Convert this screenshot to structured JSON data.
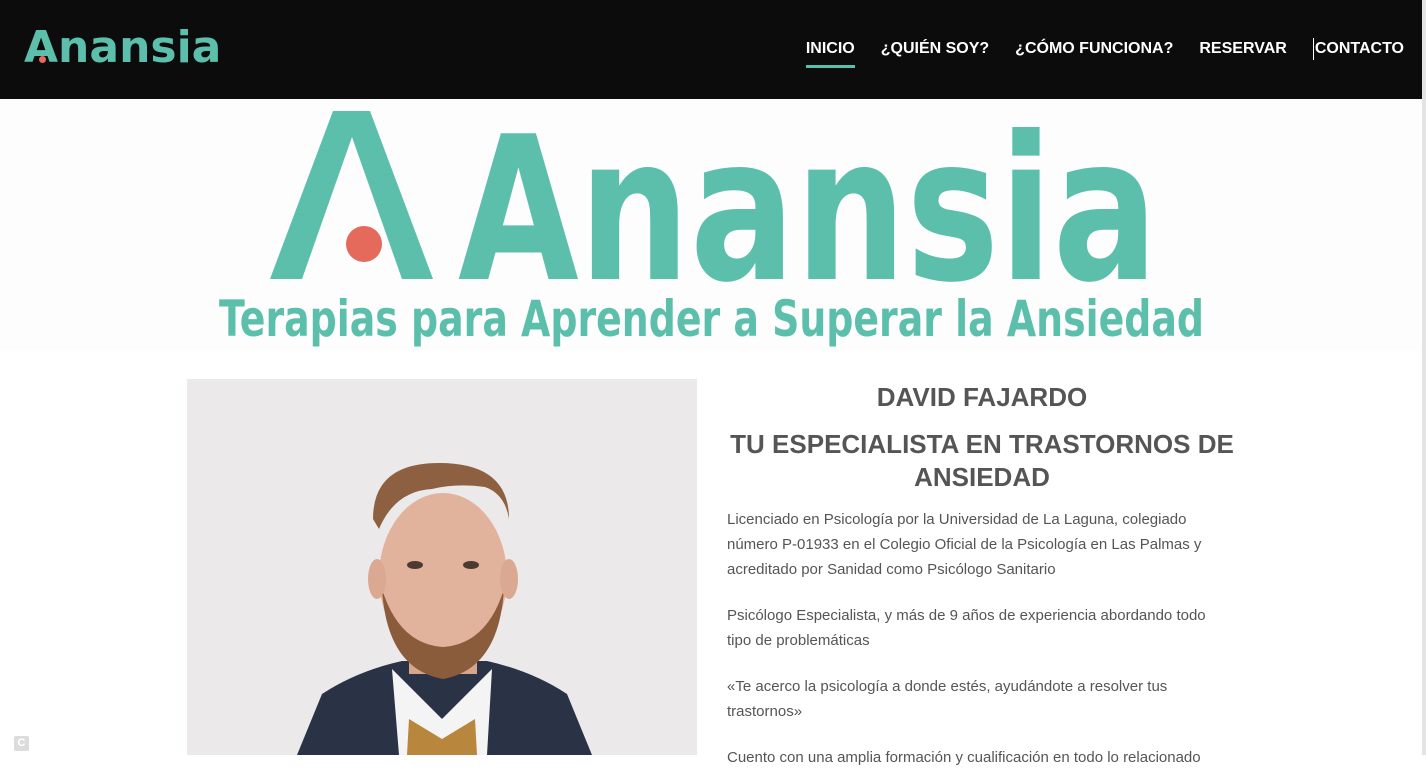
{
  "header": {
    "logo_text": "Anansia",
    "nav": [
      {
        "label": "INICIO",
        "active": true
      },
      {
        "label": "¿QUIÉN SOY?",
        "active": false
      },
      {
        "label": "¿CÓMO FUNCIONA?",
        "active": false
      },
      {
        "label": "RESERVAR",
        "active": false
      },
      {
        "label": "CONTACTO",
        "active": false
      }
    ]
  },
  "banner": {
    "brand": "Anansia",
    "tagline": "Terapias para Aprender a Superar la Ansiedad"
  },
  "profile": {
    "name": "DAVID FAJARDO",
    "subtitle": "TU ESPECIALISTA EN TRASTORNOS DE ANSIEDAD",
    "paragraphs": [
      "Licenciado en Psicología por la Universidad de La Laguna, colegiado número P-01933 en el Colegio Oficial de la Psicología en Las Palmas y acreditado por Sanidad como Psicólogo Sanitario",
      "Psicólogo Especialista, y más de 9 años de experiencia abordando todo tipo de problemáticas",
      "«Te acerco la psicología a donde estés, ayudándote a resolver tus trastornos»",
      "Cuento con una amplia formación y cualificación en todo lo relacionado"
    ]
  },
  "colors": {
    "brand_teal": "#5bbfac",
    "accent_coral": "#e66a5c",
    "header_bg": "#0c0c0c",
    "text_gray": "#555555"
  }
}
